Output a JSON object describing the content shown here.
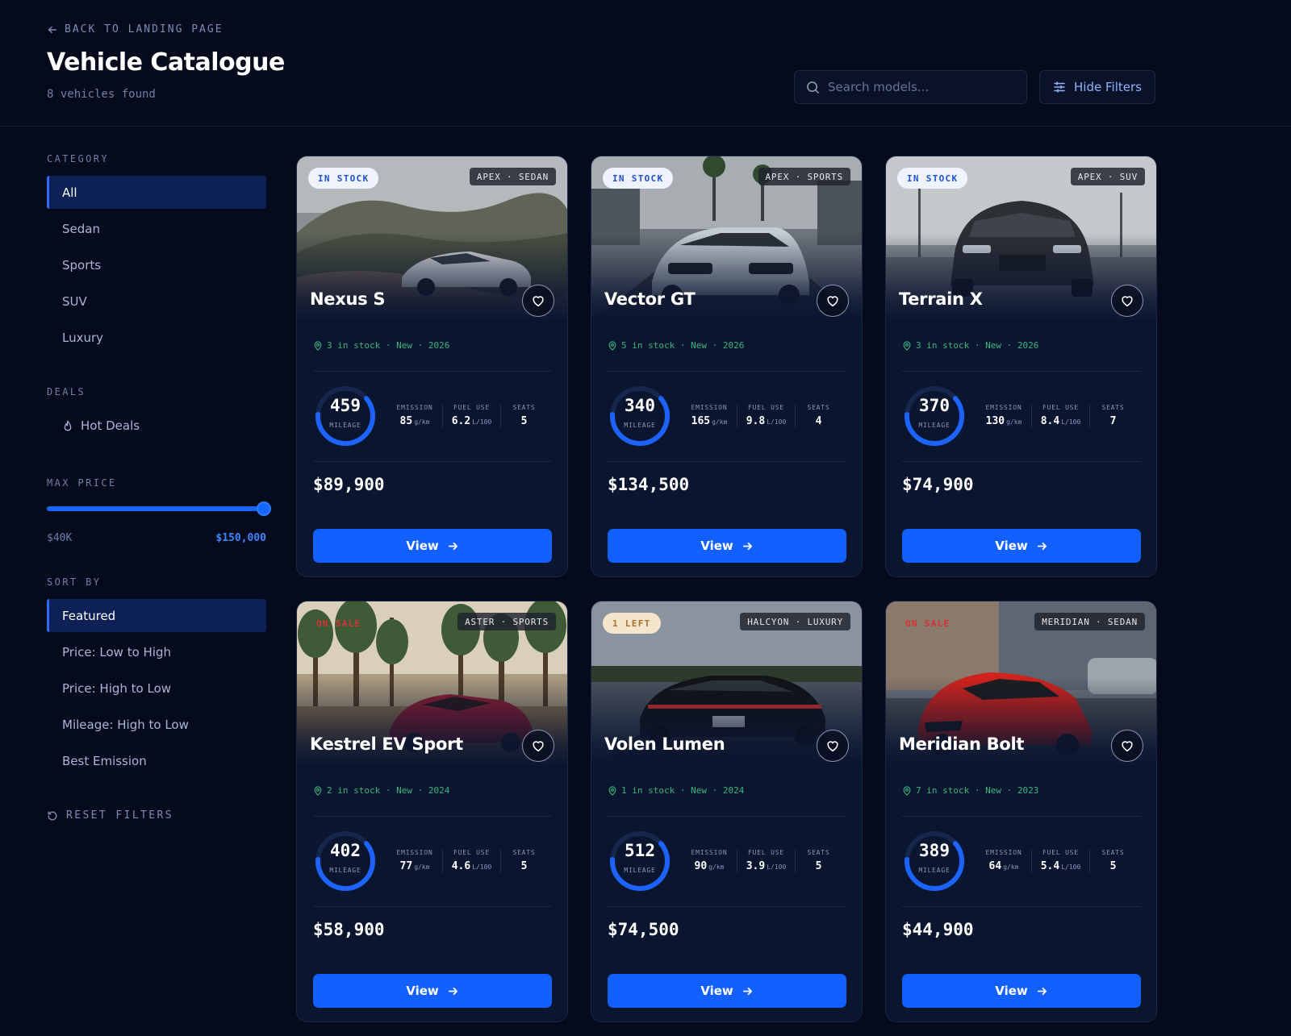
{
  "header": {
    "back_label": "Back to Landing Page",
    "title": "Vehicle Catalogue",
    "count_text": "8 vehicles found",
    "search_placeholder": "Search models...",
    "filter_button": "Hide Filters"
  },
  "sidebar": {
    "category": {
      "label": "Category",
      "items": [
        {
          "label": "All",
          "active": true
        },
        {
          "label": "Sedan",
          "active": false
        },
        {
          "label": "Sports",
          "active": false
        },
        {
          "label": "SUV",
          "active": false
        },
        {
          "label": "Luxury",
          "active": false
        }
      ]
    },
    "deals": {
      "label": "Deals",
      "hot_deals": "Hot Deals"
    },
    "max_price": {
      "label": "Max Price",
      "min": "$40K",
      "max": "$150,000",
      "fraction": 1.0
    },
    "sort": {
      "label": "Sort By",
      "items": [
        {
          "label": "Featured",
          "active": true
        },
        {
          "label": "Price: Low to High",
          "active": false
        },
        {
          "label": "Price: High to Low",
          "active": false
        },
        {
          "label": "Mileage: High to Low",
          "active": false
        },
        {
          "label": "Best Emission",
          "active": false
        }
      ]
    },
    "reset": "Reset Filters"
  },
  "labels": {
    "mileage": "MILEAGE",
    "emission": "EMISSION",
    "fuel": "FUEL USE",
    "seats": "SEATS",
    "emission_unit": "g/km",
    "fuel_unit": "L/100",
    "view": "View"
  },
  "cars": [
    {
      "name": "Nexus S",
      "stock_badge": "IN STOCK",
      "badge_style": "stock",
      "brand": "APEX · SEDAN",
      "meta": "3 in stock · New · 2026",
      "mileage": "459",
      "mileage_fraction": 0.62,
      "emission": "85",
      "fuel": "6.2",
      "seats": "5",
      "price": "$89,900",
      "scene": "coast"
    },
    {
      "name": "Vector GT",
      "stock_badge": "IN STOCK",
      "badge_style": "stock",
      "brand": "APEX · SPORTS",
      "meta": "5 in stock · New · 2026",
      "mileage": "340",
      "mileage_fraction": 0.62,
      "emission": "165",
      "fuel": "9.8",
      "seats": "4",
      "price": "$134,500",
      "scene": "street"
    },
    {
      "name": "Terrain X",
      "stock_badge": "IN STOCK",
      "badge_style": "stock",
      "brand": "APEX · SUV",
      "meta": "3 in stock · New · 2026",
      "mileage": "370",
      "mileage_fraction": 0.62,
      "emission": "130",
      "fuel": "8.4",
      "seats": "7",
      "price": "$74,900",
      "scene": "lot"
    },
    {
      "name": "Kestrel EV Sport",
      "stock_badge": "ON SALE",
      "badge_style": "sale",
      "brand": "ASTER · SPORTS",
      "meta": "2 in stock · New · 2024",
      "mileage": "402",
      "mileage_fraction": 0.62,
      "emission": "77",
      "fuel": "4.6",
      "seats": "5",
      "price": "$58,900",
      "scene": "forest"
    },
    {
      "name": "Volen Lumen",
      "stock_badge": "1 LEFT",
      "badge_style": "low",
      "brand": "HALCYON · LUXURY",
      "meta": "1 in stock · New · 2024",
      "mileage": "512",
      "mileage_fraction": 0.62,
      "emission": "90",
      "fuel": "3.9",
      "seats": "5",
      "price": "$74,500",
      "scene": "highway"
    },
    {
      "name": "Meridian Bolt",
      "stock_badge": "ON SALE",
      "badge_style": "sale",
      "brand": "MERIDIAN · SEDAN",
      "meta": "7 in stock · New · 2023",
      "mileage": "389",
      "mileage_fraction": 0.62,
      "emission": "64",
      "fuel": "5.4",
      "seats": "5",
      "price": "$44,900",
      "scene": "city"
    }
  ],
  "colors": {
    "accent": "#1260ff",
    "background": "#050b1c",
    "card": "#0a1530",
    "stock_text": "#3cb57b"
  }
}
